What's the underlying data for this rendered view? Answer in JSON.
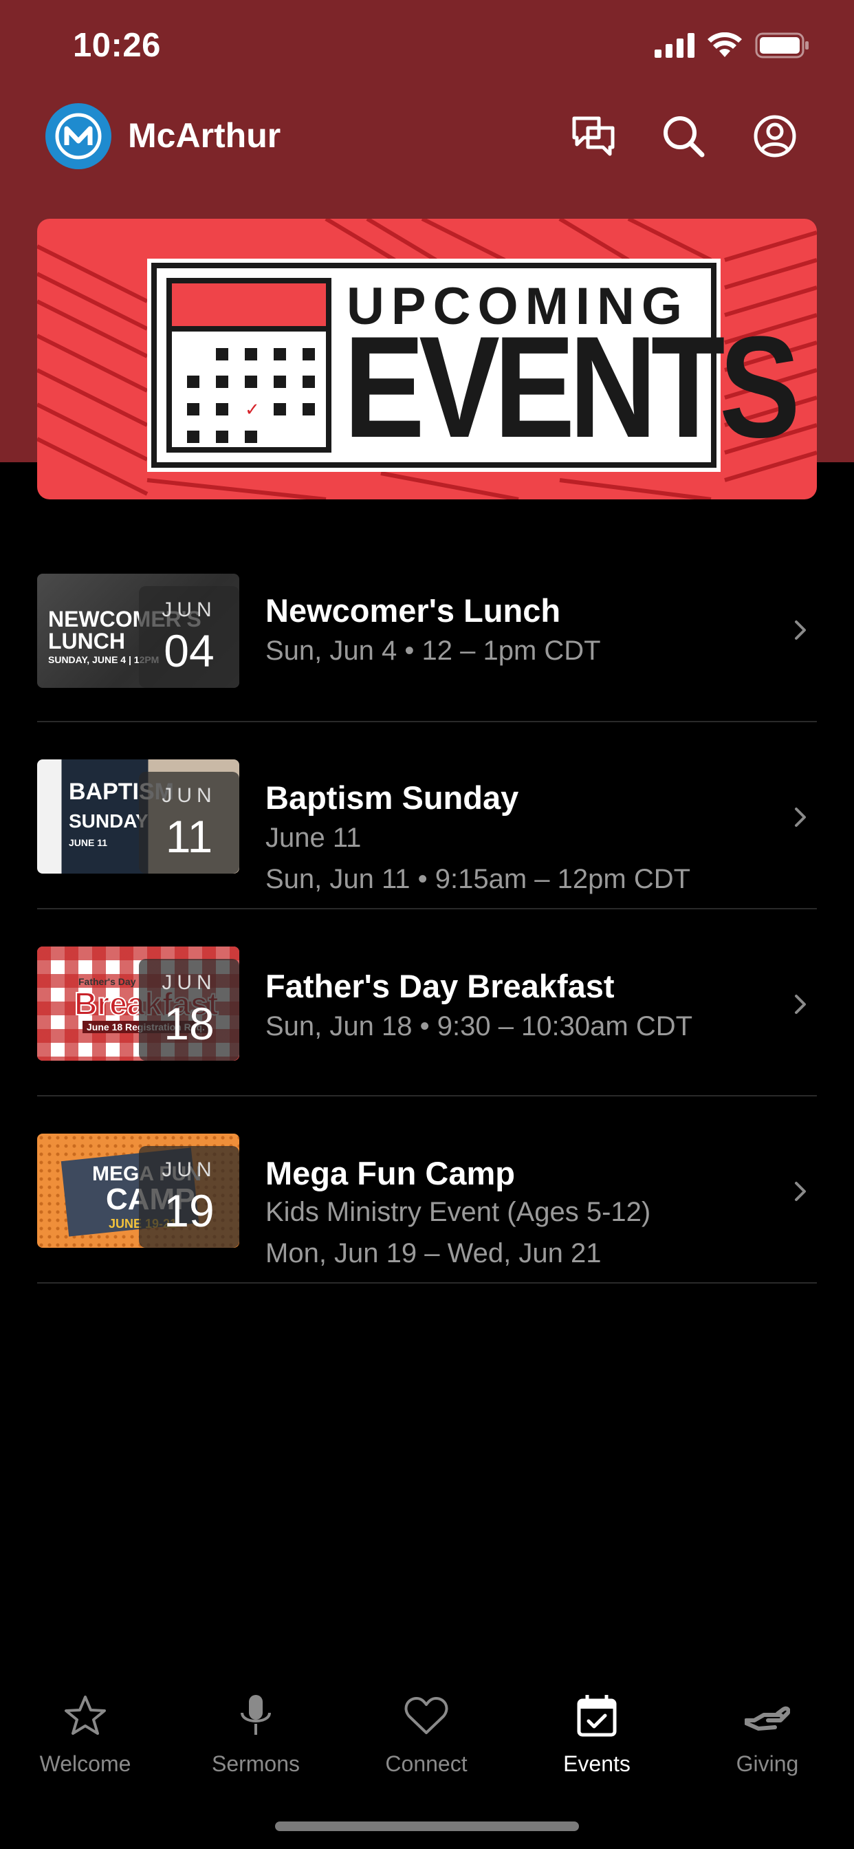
{
  "status_bar": {
    "time": "10:26"
  },
  "header": {
    "title": "McArthur",
    "logo_letter": "M"
  },
  "banner": {
    "line1": "UPCOMING",
    "line2": "EVENTS",
    "bg_color": "#ef4449"
  },
  "events": [
    {
      "title": "Newcomer's Lunch",
      "lines": [
        "Sun, Jun 4 • 12 – 1pm CDT"
      ],
      "month": "JUN",
      "day": "04",
      "thumb_text": [
        "NEWCOMER'S",
        "LUNCH",
        "SUNDAY, JUNE 4 | 12PM"
      ]
    },
    {
      "title": "Baptism Sunday",
      "lines": [
        "June 11",
        "Sun, Jun 11 • 9:15am – 12pm CDT"
      ],
      "month": "JUN",
      "day": "11",
      "thumb_text": [
        "BAPTISM",
        "SUNDAY",
        "JUNE 11"
      ]
    },
    {
      "title": "Father's Day Breakfast",
      "lines": [
        "Sun, Jun 18 • 9:30 – 10:30am CDT"
      ],
      "month": "JUN",
      "day": "18",
      "thumb_text": [
        "Father's Day",
        "Breakfast",
        "June 18 Registration Req."
      ]
    },
    {
      "title": "Mega Fun Camp",
      "lines": [
        "Kids Ministry Event (Ages 5-12)",
        "Mon, Jun 19 – Wed, Jun 21"
      ],
      "month": "JUN",
      "day": "19",
      "thumb_text": [
        "MEGA FUN",
        "CAMP",
        "JUNE 19-21"
      ]
    }
  ],
  "tabs": [
    {
      "label": "Welcome",
      "icon": "star-icon",
      "active": false
    },
    {
      "label": "Sermons",
      "icon": "microphone-icon",
      "active": false
    },
    {
      "label": "Connect",
      "icon": "heart-icon",
      "active": false
    },
    {
      "label": "Events",
      "icon": "calendar-icon",
      "active": true
    },
    {
      "label": "Giving",
      "icon": "giving-hand-icon",
      "active": false
    }
  ],
  "colors": {
    "header_bg": "#7d2529",
    "logo_blue": "#1f8bcf",
    "banner_red": "#ef4449"
  }
}
